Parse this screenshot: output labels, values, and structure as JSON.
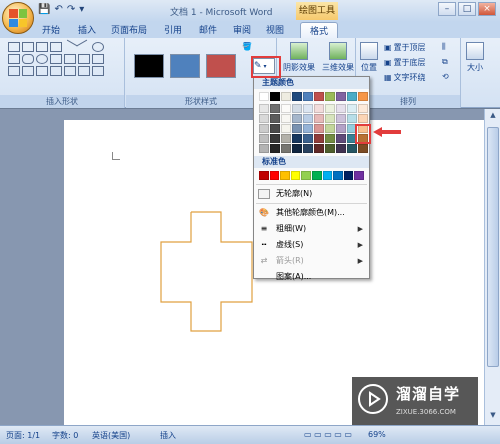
{
  "titlebar": {
    "title": "文档 1 - Microsoft Word",
    "context_tool": "绘图工具"
  },
  "tabs": [
    "开始",
    "插入",
    "页面布局",
    "引用",
    "邮件",
    "审阅",
    "视图",
    "格式"
  ],
  "ribbon": {
    "groups": {
      "insert_shapes": "插入形状",
      "shape_styles": "形状样式",
      "arrange": "排列"
    },
    "shadow_effects": "阴影效果",
    "3d_effects": "三维效果",
    "position": "位置",
    "bring_to_front": "置于顶层",
    "send_to_back": "置于底层",
    "text_wrap": "文字环绕",
    "size": "大小"
  },
  "dropdown": {
    "theme_colors": "主题颜色",
    "standard_colors": "标准色",
    "no_outline": "无轮廓(N)",
    "more_colors": "其他轮廓颜色(M)...",
    "weight": "粗细(W)",
    "dashes": "虚线(S)",
    "arrows": "箭头(R)",
    "pattern": "图案(A)..."
  },
  "status": {
    "page": "页面: 1/1",
    "words": "字数: 0",
    "language": "英语(美国)",
    "insert": "插入",
    "zoom": "69%"
  },
  "watermark": {
    "text": "溜溜自学",
    "url": "ZIXUE.3066.COM"
  },
  "colors": {
    "theme_top": [
      "#ffffff",
      "#000000",
      "#eeece1",
      "#1f497d",
      "#4f81bd",
      "#c0504d",
      "#9bbb59",
      "#8064a2",
      "#4bacc6",
      "#f79646"
    ],
    "standard": [
      "#c00000",
      "#ff0000",
      "#ffc000",
      "#ffff00",
      "#92d050",
      "#00b050",
      "#00b0f0",
      "#0070c0",
      "#002060",
      "#7030a0"
    ],
    "shape_outline": "#e0a040",
    "highlight": "#e23c3c"
  }
}
